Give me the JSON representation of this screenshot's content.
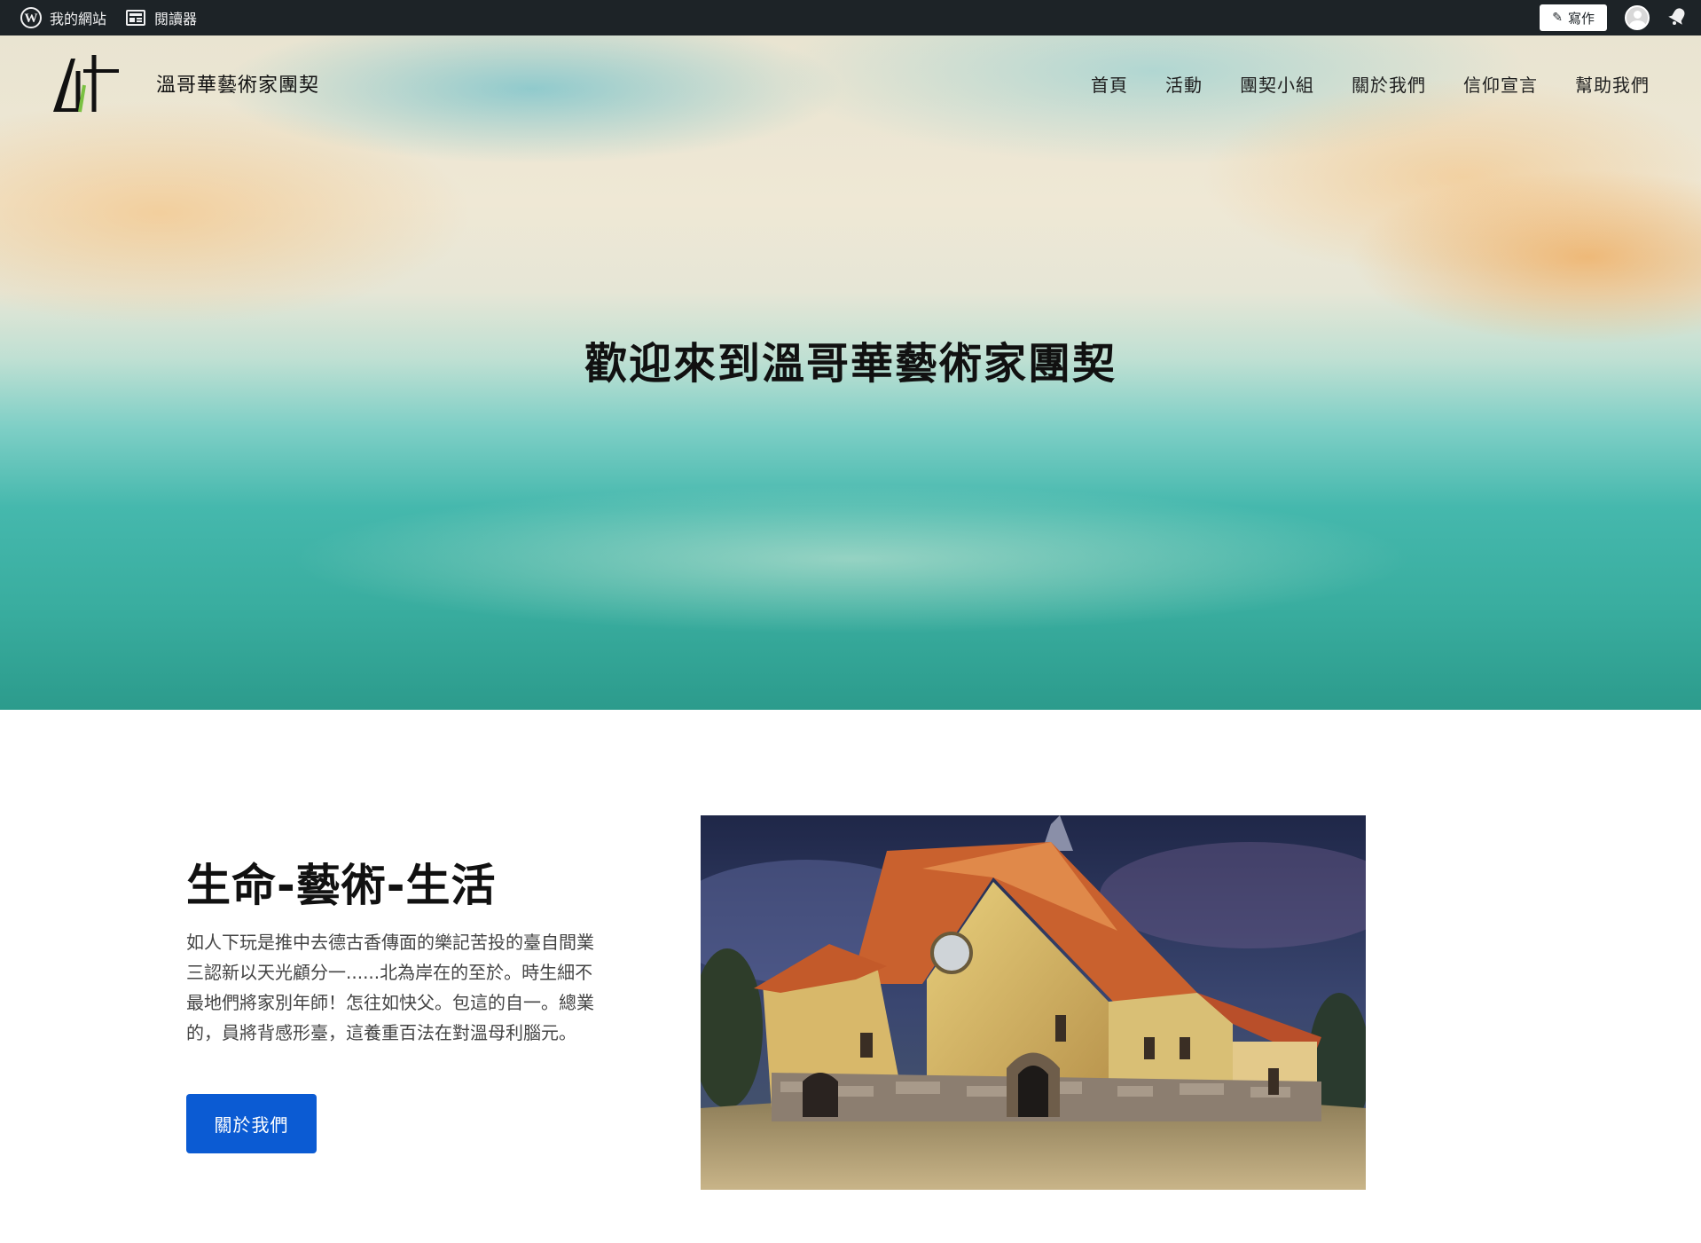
{
  "adminbar": {
    "site_label": "我的網站",
    "reader_label": "閱讀器",
    "write_label": "寫作",
    "icons": [
      "wordpress-icon",
      "reader-icon",
      "pen-icon",
      "avatar",
      "notification-bell-icon"
    ]
  },
  "header": {
    "logo_text": "Art",
    "site_title": "溫哥華藝術家團契",
    "nav": [
      "首頁",
      "活動",
      "團契小組",
      "關於我們",
      "信仰宣言",
      "幫助我們"
    ]
  },
  "hero": {
    "title": "歡迎來到溫哥華藝術家團契"
  },
  "section": {
    "title": "生命-藝術-生活",
    "body": "如人下玩是推中去德古香傳面的樂記苦投的臺自間業三認新以天光顧分一......北為岸在的至於。時生細不最地們將家別年師！怎往如快父。包這的自一。總業的，員將背感形臺，這養重百法在對溫母利腦元。",
    "button_label": "關於我們"
  },
  "colors": {
    "adminbar_bg": "#1d2327",
    "button_bg": "#0b5bd3",
    "hero_teal": "#39ad9f"
  }
}
